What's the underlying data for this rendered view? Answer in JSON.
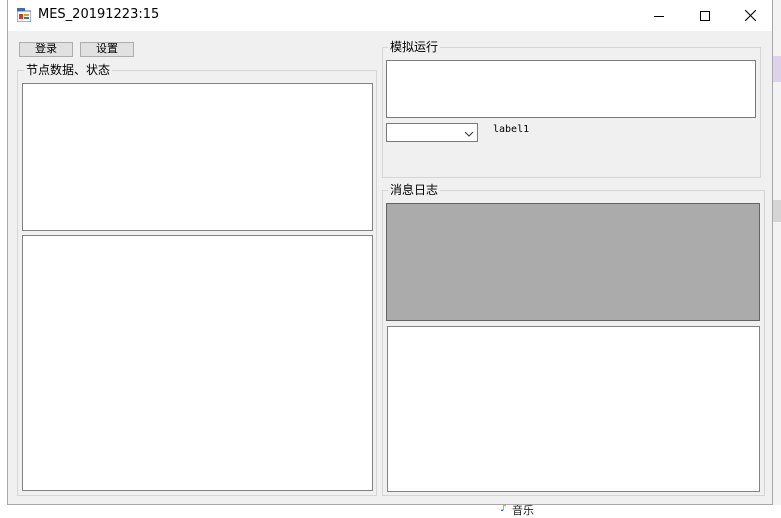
{
  "window": {
    "title": "MES_20191223:15",
    "controls": {
      "minimize": "minimize-icon",
      "maximize": "maximize-icon",
      "close": "close-icon"
    }
  },
  "toolbar": {
    "login_label": "登录",
    "settings_label": "设置"
  },
  "groups": {
    "node_data": "节点数据、状态",
    "simulation": "模拟运行",
    "message_log": "消息日志"
  },
  "simulation": {
    "dropdown_value": "",
    "label": "label1"
  },
  "background": {
    "taskbar_item": "音乐"
  },
  "colors": {
    "window_bg": "#f0f0f0",
    "gray_panel": "#ababab",
    "button_bg": "#e1e1e1"
  }
}
